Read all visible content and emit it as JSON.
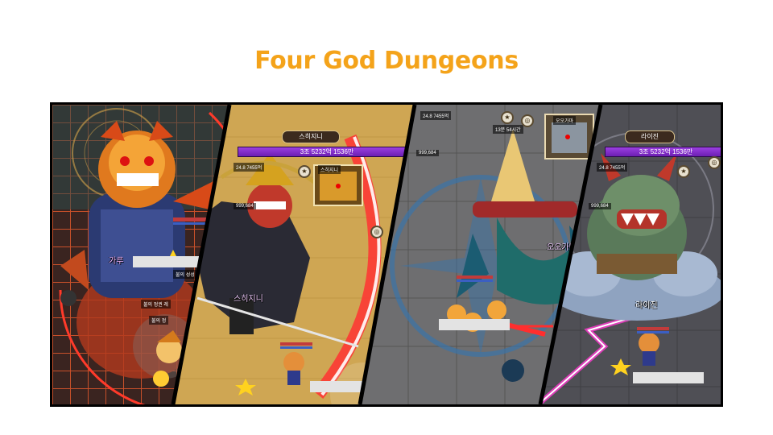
{
  "title": "Four God Dungeons",
  "colors": {
    "title": "#f4a31a"
  },
  "panels": [
    {
      "id": "fire-dragon",
      "labels": {
        "boss_tag": "가루",
        "p1": "불의 성성",
        "p2": "불의 정권 레",
        "p3": "불의 정"
      }
    },
    {
      "id": "samurai",
      "labels": {
        "boss_name": "스히지니",
        "boss_hp": "3조 5232억 1536만",
        "stat1": "24.8 7455억",
        "gold": "999,684",
        "minimap_title": "스히지니",
        "boss_tag": "스히지니"
      }
    },
    {
      "id": "helmet-dragon",
      "labels": {
        "stat1": "24.8 7455억",
        "gold": "999,684",
        "minimap_title": "오오가마",
        "timer": "13분 54시간",
        "boss_tag": "오오가마"
      }
    },
    {
      "id": "thunder-oni",
      "labels": {
        "boss_name": "라이진",
        "boss_hp": "3조 5232억 1536만",
        "stat1": "24.8 7455억",
        "gold": "999,684",
        "boss_tag": "라이진"
      }
    }
  ]
}
